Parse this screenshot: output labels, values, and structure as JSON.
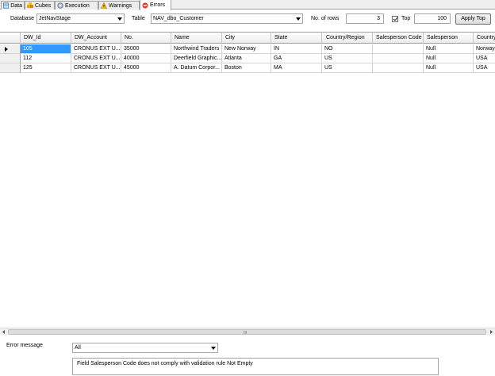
{
  "tabs": [
    {
      "label": "Data",
      "icon": "grid-icon",
      "active": false
    },
    {
      "label": "Cubes",
      "icon": "cubes-icon",
      "active": false
    },
    {
      "label": "Execution",
      "icon": "gear-icon",
      "active": false
    },
    {
      "label": "Warnings",
      "icon": "warning-icon",
      "active": false
    },
    {
      "label": "Errors",
      "icon": "error-icon",
      "active": true
    }
  ],
  "toolbar": {
    "database_label": "Database",
    "database_value": "JetNavStage",
    "table_label": "Table",
    "table_value": "NAV_dbo_Customer",
    "rows_label": "No. of rows",
    "rows_value": "3",
    "top_checked": true,
    "top_label": "Top",
    "top_value": "100",
    "apply_label": "Apply Top"
  },
  "grid": {
    "columns": [
      "DW_Id",
      "DW_Account",
      "No.",
      "Name",
      "City",
      "State",
      "Country/Region",
      "Salesperson Code",
      "Salesperson",
      "Country"
    ],
    "rows": [
      [
        "105",
        "CRONUS EXT U...",
        "35000",
        "Northwind Traders",
        "New Norway",
        "IN",
        "NO",
        "",
        "Null",
        "Norway"
      ],
      [
        "112",
        "CRONUS EXT U...",
        "40000",
        "Deerfield Graphic...",
        "Atlanta",
        "GA",
        "US",
        "",
        "Null",
        "USA"
      ],
      [
        "125",
        "CRONUS EXT U...",
        "45000",
        "A. Datum Corpor...",
        "Boston",
        "MA",
        "US",
        "",
        "Null",
        "USA"
      ]
    ],
    "selected_row": 0,
    "selected_col": 0
  },
  "scrollbar": {
    "grip": "III"
  },
  "bottom": {
    "error_label": "Error message",
    "filter_value": "All",
    "message": "Field Salesperson Code does not comply with validation rule Not Empty"
  },
  "colors": {
    "selection": "#3399ff",
    "accent_error": "#e03a2a",
    "warning": "#f2c200"
  }
}
